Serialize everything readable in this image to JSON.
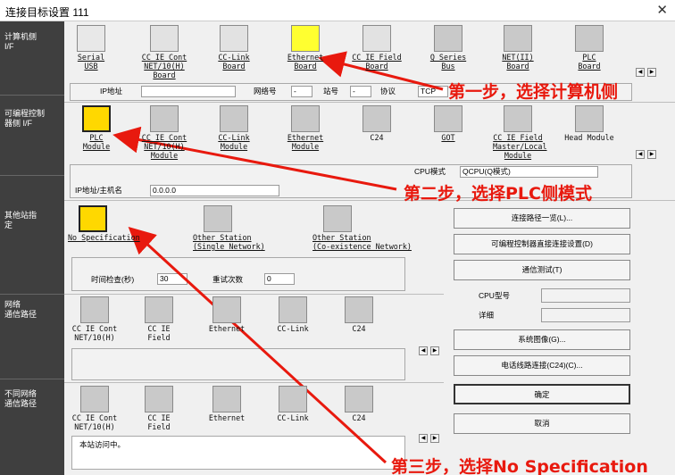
{
  "window": {
    "title": "连接目标设置 111",
    "close_glyph": "✕"
  },
  "sidebar": {
    "pc_side": "计算机侧\nI/F",
    "plc_side": "可编程控制\n器侧 I/F",
    "other_station": "其他站指\n定",
    "network_route": "网络\n通信路径",
    "diff_network": "不同网络\n通信路径"
  },
  "pc_if": {
    "items": [
      {
        "label": "Serial\nUSB",
        "icon": "serial-usb-icon"
      },
      {
        "label": "CC IE Cont\nNET/10(H)\nBoard",
        "icon": "cc-ie-cont-icon"
      },
      {
        "label": "CC-Link\nBoard",
        "icon": "cc-link-icon"
      },
      {
        "label": "Ethernet\nBoard",
        "icon": "ethernet-icon"
      },
      {
        "label": "CC IE Field\nBoard",
        "icon": "cc-ie-field-icon"
      },
      {
        "label": "Q Series\nBus",
        "icon": "q-series-bus-icon"
      },
      {
        "label": "NET(II)\nBoard",
        "icon": "net-ii-icon"
      },
      {
        "label": "PLC\nBoard",
        "icon": "plc-board-icon"
      }
    ],
    "ip_label": "IP地址",
    "network_label": "网络号",
    "network_value": "-",
    "station_label": "站号",
    "station_value": "-",
    "protocol_label": "协议",
    "protocol_value": "TCP"
  },
  "plc_if": {
    "items": [
      {
        "label": "PLC\nModule",
        "icon": "plc-module-icon"
      },
      {
        "label": "CC IE Cont\nNET/10(H)\nModule",
        "icon": "cc-ie-cont-module-icon"
      },
      {
        "label": "CC-Link\nModule",
        "icon": "cc-link-module-icon"
      },
      {
        "label": "Ethernet\nModule",
        "icon": "ethernet-module-icon"
      },
      {
        "label": "C24",
        "icon": "c24-icon"
      },
      {
        "label": "GOT",
        "icon": "got-icon"
      },
      {
        "label": "CC IE Field\nMaster/Local\nModule",
        "icon": "cc-ie-field-master-icon"
      },
      {
        "label": "Head Module",
        "icon": "head-module-icon"
      }
    ],
    "cpu_mode_label": "CPU模式",
    "cpu_mode_value": "QCPU(Q模式)",
    "ip_host_label": "IP地址/主机名",
    "ip_host_value": "0.0.0.0"
  },
  "other_station": {
    "items": [
      {
        "label": "No Specification",
        "icon": "no-specification-icon"
      },
      {
        "label": "Other Station\n(Single Network)",
        "icon": "other-station-single-icon"
      },
      {
        "label": "Other Station\n(Co-existence Network)",
        "icon": "other-station-coexist-icon"
      }
    ],
    "time_check_label": "时间检查(秒)",
    "time_check_value": "30",
    "retry_label": "重试次数",
    "retry_value": "0"
  },
  "network_route": {
    "items": [
      {
        "label": "CC IE Cont\nNET/10(H)",
        "icon": "route-cc-ie-cont-icon"
      },
      {
        "label": "CC IE\nField",
        "icon": "route-cc-ie-field-icon"
      },
      {
        "label": "Ethernet",
        "icon": "route-ethernet-icon"
      },
      {
        "label": "CC-Link",
        "icon": "route-cc-link-icon"
      },
      {
        "label": "C24",
        "icon": "route-c24-icon"
      }
    ]
  },
  "diff_network": {
    "items": [
      {
        "label": "CC IE Cont\nNET/10(H)",
        "icon": "diff-cc-ie-cont-icon"
      },
      {
        "label": "CC IE\nField",
        "icon": "diff-cc-ie-field-icon"
      },
      {
        "label": "Ethernet",
        "icon": "diff-ethernet-icon"
      },
      {
        "label": "CC-Link",
        "icon": "diff-cc-link-icon"
      },
      {
        "label": "C24",
        "icon": "diff-c24-icon"
      }
    ],
    "status": "本站访问中。"
  },
  "buttons": {
    "route_list": "连接路径一览(L)...",
    "direct_connect": "可编程控制器直接连接设置(D)",
    "comm_test": "通信测试(T)",
    "system_image": "系统图像(G)...",
    "phone_line": "电话线路连接(C24)(C)...",
    "ok": "确定",
    "cancel": "取消"
  },
  "cpu_info": {
    "type_label": "CPU型号",
    "detail_label": "详细"
  },
  "annotations": {
    "step1": "第一步，选择计算机侧",
    "step2": "第二步，选择PLC侧模式",
    "step3": "第三步，选择No Specification",
    "color": "#e8190e"
  }
}
